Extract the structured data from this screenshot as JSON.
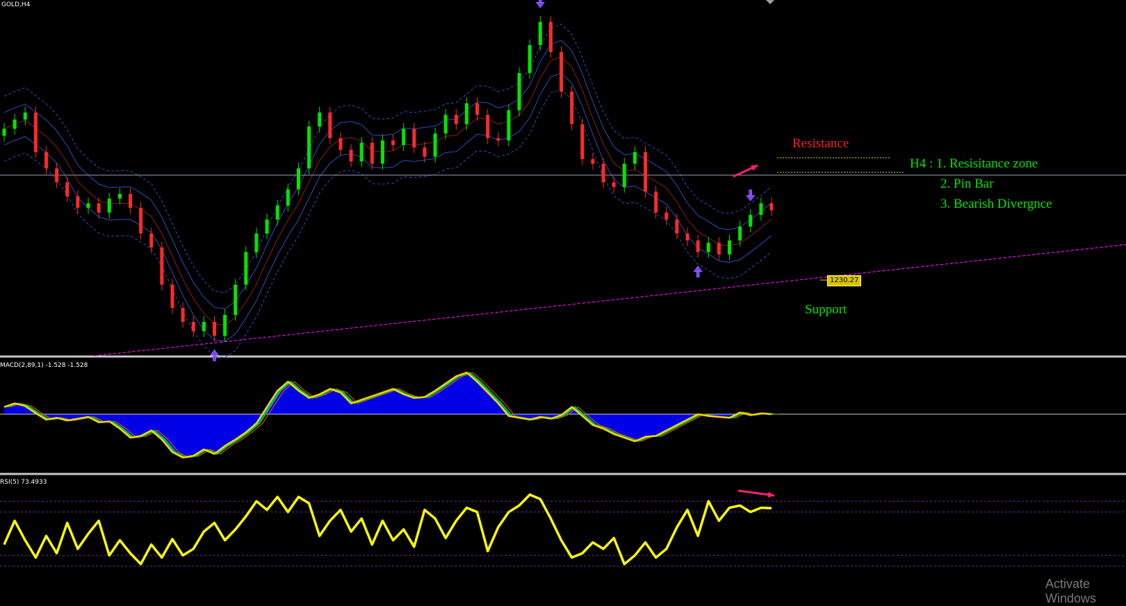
{
  "colors": {
    "background": "#000000",
    "bull": "#00e600",
    "bear": "#ff2a2a",
    "bands": "#2c4fbf",
    "macd_fill": "#0000e6",
    "rsi": "#ffff00",
    "support_line": "#ff00ff",
    "arrow": "#ff1e78",
    "separator": "#c8c8c8",
    "note_green": "#00e600",
    "note_red": "#ff1e1e"
  },
  "main_panel": {
    "symbol_label": "GOLD,H4",
    "price_tag": "1230.27",
    "resistance_label": "Resistance",
    "support_label": "Support",
    "notes": {
      "line1": "H4 : 1.  Resisitance zone",
      "line2": "2.  Pin Bar",
      "line3": "3.  Bearish Divergnce"
    }
  },
  "macd_panel": {
    "label": "MACD(2,89,1) -1.528 -1.528"
  },
  "rsi_panel": {
    "label": "RSI(5) 73.4933",
    "current_value": 73.4933
  },
  "watermark": "Activate Windows",
  "chart_data": [
    {
      "type": "candlestick",
      "title": "GOLD,H4",
      "series": [
        {
          "name": "close",
          "values": [
            1285,
            1289,
            1292,
            1275,
            1268,
            1262,
            1256,
            1251,
            1253,
            1249,
            1255,
            1257,
            1251,
            1240,
            1234,
            1218,
            1208,
            1202,
            1198,
            1202,
            1196,
            1205,
            1218,
            1232,
            1240,
            1246,
            1252,
            1259,
            1268,
            1286,
            1292,
            1281,
            1276,
            1271,
            1279,
            1270,
            1280,
            1278,
            1285,
            1277,
            1273,
            1283,
            1291,
            1287,
            1296,
            1291,
            1281,
            1280,
            1293,
            1309,
            1321,
            1331,
            1318,
            1301,
            1287,
            1272,
            1270,
            1262,
            1260,
            1270,
            1275,
            1258,
            1249,
            1246,
            1240,
            1237,
            1232,
            1236,
            1231,
            1237,
            1243,
            1248,
            1253,
            1250
          ]
        }
      ],
      "annotations": [
        "Resistance",
        "Support",
        "1230.27"
      ]
    },
    {
      "type": "area",
      "title": "MACD(2,89,1) -1.528 -1.528",
      "series": [
        {
          "name": "MACD",
          "values": [
            0.8,
            1.2,
            0.9,
            0.1,
            -0.6,
            -0.4,
            -0.7,
            -0.5,
            -0.3,
            -0.9,
            -0.8,
            -1.6,
            -2.6,
            -2.4,
            -1.8,
            -2.8,
            -4.2,
            -4.8,
            -4.6,
            -3.9,
            -4.4,
            -3.5,
            -2.8,
            -2.0,
            -1.0,
            0.8,
            2.6,
            3.6,
            2.6,
            1.8,
            2.2,
            2.8,
            2.4,
            1.2,
            1.6,
            2.0,
            2.4,
            2.8,
            2.2,
            1.8,
            1.9,
            2.6,
            3.4,
            4.2,
            4.6,
            3.6,
            2.4,
            1.2,
            -0.2,
            -0.4,
            -0.6,
            -0.3,
            -0.5,
            -0.1,
            0.8,
            -0.2,
            -1.2,
            -1.6,
            -2.2,
            -2.6,
            -3.0,
            -2.5,
            -2.4,
            -1.8,
            -1.2,
            -0.6,
            0.0,
            -0.2,
            -0.3,
            -0.4,
            0.2,
            -0.1,
            0.1,
            0.0
          ]
        }
      ]
    },
    {
      "type": "line",
      "title": "RSI(5) 73.4933",
      "ylim": [
        0,
        100
      ],
      "series": [
        {
          "name": "RSI",
          "values": [
            40,
            62,
            44,
            28,
            48,
            32,
            60,
            36,
            50,
            62,
            30,
            44,
            32,
            22,
            40,
            28,
            45,
            30,
            36,
            52,
            60,
            44,
            54,
            66,
            80,
            72,
            84,
            70,
            84,
            78,
            48,
            62,
            72,
            52,
            64,
            40,
            62,
            44,
            54,
            38,
            72,
            64,
            46,
            62,
            74,
            70,
            34,
            56,
            70,
            76,
            86,
            82,
            64,
            44,
            28,
            32,
            42,
            36,
            46,
            22,
            30,
            42,
            28,
            36,
            56,
            72,
            48,
            80,
            62,
            74,
            76,
            70,
            74,
            73.5
          ]
        }
      ]
    }
  ]
}
